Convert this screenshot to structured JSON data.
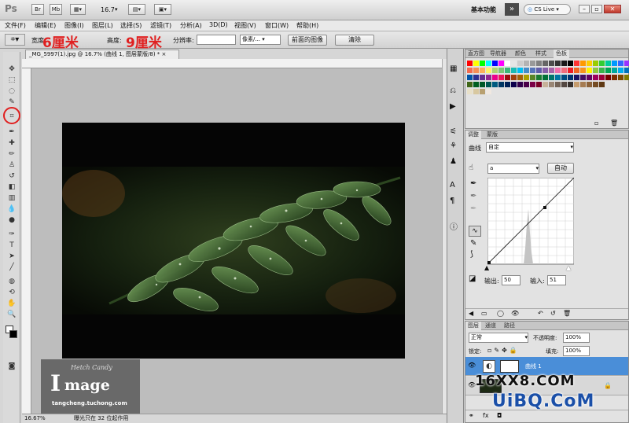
{
  "app": {
    "logo": "Ps",
    "zoom_value": "16.7",
    "workspace_label": "基本功能",
    "cs_live_label": "CS Live"
  },
  "menu": [
    "文件(F)",
    "编辑(E)",
    "图像(I)",
    "图层(L)",
    "选择(S)",
    "滤镜(T)",
    "分析(A)",
    "3D(D)",
    "视图(V)",
    "窗口(W)",
    "帮助(H)"
  ],
  "options": {
    "width_label": "宽度:",
    "width_value": "6厘米",
    "height_label": "高度:",
    "height_value": "9厘米",
    "resolution_label": "分辨率:",
    "unit_value": "像素/...",
    "front_image_button": "前面的图像",
    "clear_button": "清除"
  },
  "document": {
    "tab_title": "_MG_5997(1).jpg @ 16.7% (曲线 1, 图层蒙版/8) *",
    "status_zoom": "16.67%",
    "status_text": "曝光只在 32 位起作用"
  },
  "watermark": {
    "signature": "Hetch Candy",
    "logo_text": "mage",
    "site": "tangcheng.tuchong.com"
  },
  "swatch_panel": {
    "tabs": [
      "直方图",
      "导航器",
      "颜色",
      "样式",
      "色板"
    ],
    "active": "色板"
  },
  "adjust_panel": {
    "tabs": [
      "调整",
      "蒙版"
    ],
    "active": "调整",
    "preset_label": "曲线",
    "preset_value": "自定",
    "channel_value": "a",
    "auto_button": "自动",
    "output_label": "输出:",
    "output_value": "50",
    "input_label": "输入:",
    "input_value": "51"
  },
  "layers_panel": {
    "tabs": [
      "图层",
      "通道",
      "路径"
    ],
    "active": "图层",
    "blend_mode": "正常",
    "opacity_label": "不透明度:",
    "opacity_value": "100%",
    "lock_label": "锁定:",
    "fill_label": "填充:",
    "fill_value": "100%",
    "layers": [
      "曲线 1"
    ]
  },
  "site_watermark": {
    "line1": "16XX8.COM",
    "line2": "UiBQ.CoM"
  },
  "colors": {
    "accent": "#3a86d8",
    "annotation_red": "#e02020",
    "selected_layer": "#4a8ed8"
  }
}
